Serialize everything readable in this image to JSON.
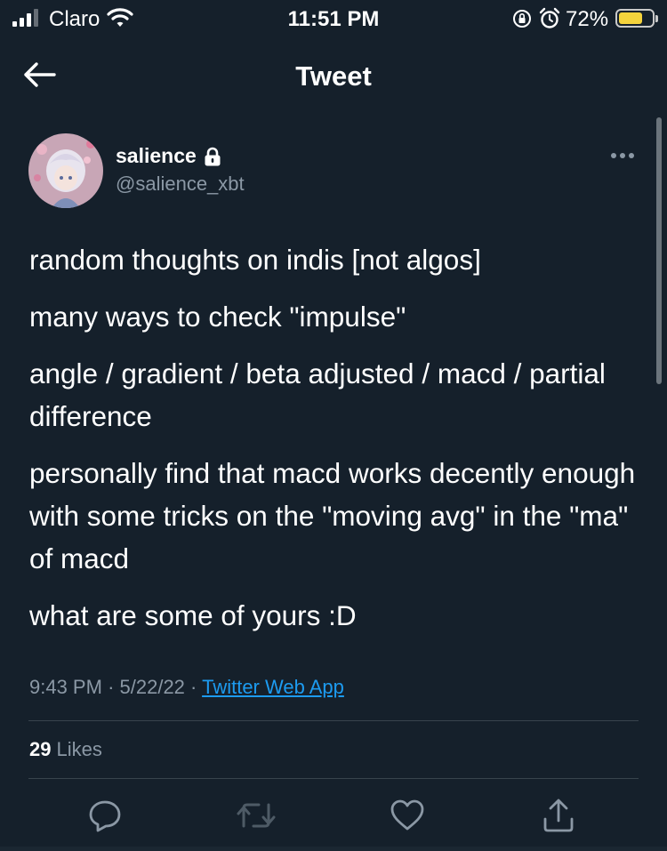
{
  "status_bar": {
    "carrier": "Claro",
    "time": "11:51 PM",
    "battery_percent": "72%",
    "battery_level": 0.72,
    "icons": [
      "signal-icon",
      "wifi-icon",
      "orientation-lock-icon",
      "alarm-icon",
      "battery-icon"
    ]
  },
  "nav": {
    "title": "Tweet",
    "back_icon": "arrow-left-icon"
  },
  "tweet": {
    "author_name": "salience",
    "author_handle": "@salience_xbt",
    "protected_icon": "lock-icon",
    "more_icon": "more-horizontal-icon",
    "paragraphs": [
      "random thoughts on indis [not algos]",
      "many ways to check \"impulse\"",
      "angle / gradient / beta adjusted / macd / partial difference",
      "personally find that macd works decently enough with some tricks on the \"moving avg\" in the \"ma\" of macd",
      "what are some of yours :D"
    ],
    "time": "9:43 PM",
    "separator": "·",
    "date": "5/22/22",
    "source": "Twitter Web App",
    "likes_count": "29",
    "likes_label": "Likes"
  },
  "actions": [
    "reply-icon",
    "retweet-icon",
    "like-icon",
    "share-icon"
  ],
  "colors": {
    "background": "#15202b",
    "secondary_text": "#8b98a5",
    "link": "#1d9bf0",
    "divider": "#38444d",
    "battery": "#f4d33c"
  }
}
